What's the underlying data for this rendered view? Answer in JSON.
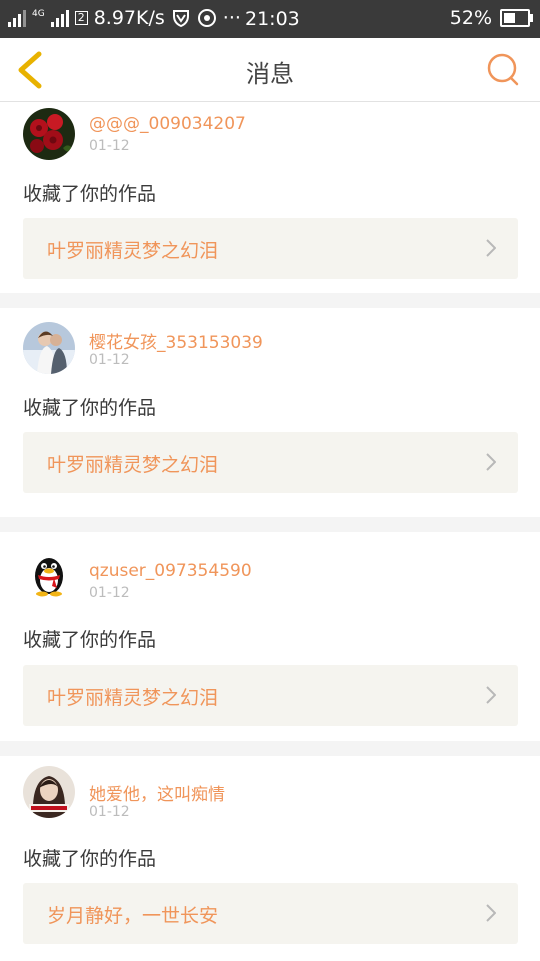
{
  "status_bar": {
    "network_label": "4G",
    "sim_label": "2",
    "speed": "8.97K/s",
    "overflow": "···",
    "time": "21:03",
    "battery_percent": "52%",
    "battery_level": 0.52
  },
  "header": {
    "title": "消息",
    "back_icon": "chevron-left-icon",
    "search_icon": "search-icon",
    "accent_color": "#f0955a",
    "back_color": "#e8b200"
  },
  "messages": [
    {
      "user": "@@@_009034207",
      "date": "01-12",
      "action": "收藏了你的作品",
      "work_title": "叶罗丽精灵梦之幻泪",
      "avatar": "avatar-red-roses"
    },
    {
      "user": "樱花女孩_353153039",
      "date": "01-12",
      "action": "收藏了你的作品",
      "work_title": "叶罗丽精灵梦之幻泪",
      "avatar": "avatar-couple-photo"
    },
    {
      "user": "qzuser_097354590",
      "date": "01-12",
      "action": "收藏了你的作品",
      "work_title": "叶罗丽精灵梦之幻泪",
      "avatar": "avatar-qq-penguin"
    },
    {
      "user": "她爱他，这叫痴情",
      "date": "01-12",
      "action": "收藏了你的作品",
      "work_title": "岁月静好，一世长安",
      "avatar": "avatar-girl-photo"
    }
  ]
}
